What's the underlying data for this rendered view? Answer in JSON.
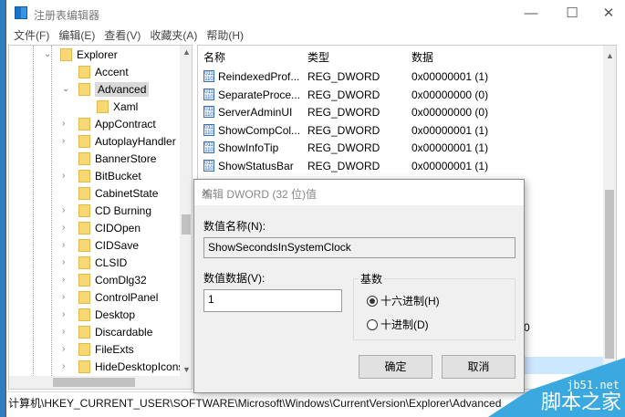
{
  "window": {
    "title": "注册表编辑器",
    "minimize": "—",
    "maximize": "☐",
    "close": "✕"
  },
  "menu": [
    "文件(F)",
    "编辑(E)",
    "查看(V)",
    "收藏夹(A)",
    "帮助(H)"
  ],
  "tree": [
    {
      "label": "Explorer",
      "depth": 0,
      "exp": "⌄"
    },
    {
      "label": "Accent",
      "depth": 1,
      "exp": ""
    },
    {
      "label": "Advanced",
      "depth": 1,
      "exp": "⌄",
      "selected": true
    },
    {
      "label": "Xaml",
      "depth": 2,
      "exp": ""
    },
    {
      "label": "AppContract",
      "depth": 1,
      "exp": "›"
    },
    {
      "label": "AutoplayHandler",
      "depth": 1,
      "exp": "›"
    },
    {
      "label": "BannerStore",
      "depth": 1,
      "exp": ""
    },
    {
      "label": "BitBucket",
      "depth": 1,
      "exp": "›"
    },
    {
      "label": "CabinetState",
      "depth": 1,
      "exp": ""
    },
    {
      "label": "CD Burning",
      "depth": 1,
      "exp": "›"
    },
    {
      "label": "CIDOpen",
      "depth": 1,
      "exp": "›"
    },
    {
      "label": "CIDSave",
      "depth": 1,
      "exp": "›"
    },
    {
      "label": "CLSID",
      "depth": 1,
      "exp": "›"
    },
    {
      "label": "ComDlg32",
      "depth": 1,
      "exp": "›"
    },
    {
      "label": "ControlPanel",
      "depth": 1,
      "exp": "›"
    },
    {
      "label": "Desktop",
      "depth": 1,
      "exp": "›"
    },
    {
      "label": "Discardable",
      "depth": 1,
      "exp": "›"
    },
    {
      "label": "FileExts",
      "depth": 1,
      "exp": "›"
    },
    {
      "label": "HideDesktopIcons",
      "depth": 1,
      "exp": "›"
    }
  ],
  "list": {
    "headers": {
      "name": "名称",
      "type": "类型",
      "data": "数据"
    },
    "rows": [
      {
        "name": "ReindexedProf...",
        "type": "REG_DWORD",
        "data": "0x00000001 (1)"
      },
      {
        "name": "SeparateProce...",
        "type": "REG_DWORD",
        "data": "0x00000000 (0)"
      },
      {
        "name": "ServerAdminUI",
        "type": "REG_DWORD",
        "data": "0x00000000 (0)"
      },
      {
        "name": "ShowCompCol...",
        "type": "REG_DWORD",
        "data": "0x00000001 (1)"
      },
      {
        "name": "ShowInfoTip",
        "type": "REG_DWORD",
        "data": "0x00000001 (1)"
      },
      {
        "name": "ShowStatusBar",
        "type": "REG_DWORD",
        "data": "0x00000001 (1)"
      }
    ],
    "partial": "0"
  },
  "status": "计算机\\HKEY_CURRENT_USER\\SOFTWARE\\Microsoft\\Windows\\CurrentVersion\\Explorer\\Advanced",
  "dialog": {
    "title": "编辑 DWORD (32 位)值",
    "close": "✕",
    "name_label": "数值名称(N):",
    "name_value": "ShowSecondsInSystemClock",
    "data_label": "数值数据(V):",
    "data_value": "1",
    "base_label": "基数",
    "hex": "十六进制(H)",
    "dec": "十进制(D)",
    "ok": "确定",
    "cancel": "取消"
  },
  "watermark": {
    "site": "jb51.net",
    "name": "脚本之家"
  }
}
